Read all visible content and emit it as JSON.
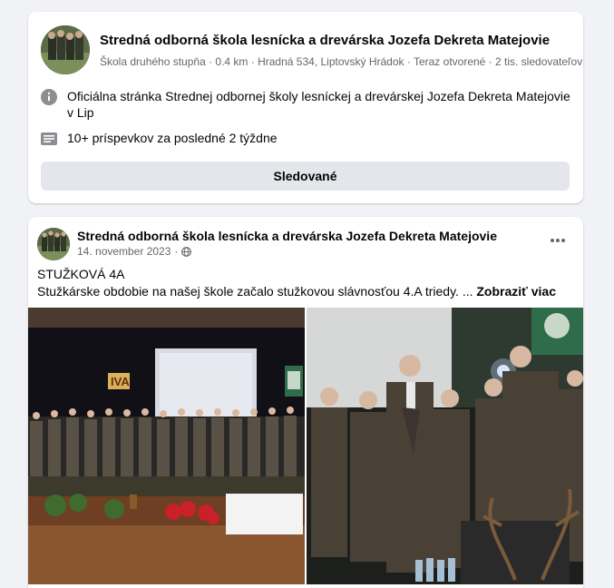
{
  "page_card": {
    "name": "Stredná odborná škola lesnícka a drevárska Jozefa Dekreta Matejovie",
    "meta": "Škola druhého stupňa · 0.4 km · Hradná 534, Liptovský Hrádok · Teraz otvorené · 2 tis. sledovateľov",
    "about_text": "Oficiálna stránka Strednej odbornej školy lesníckej a drevárskej Jozefa Dekreta Matejovie v Lip",
    "posts_text": "10+ príspevkov za posledné 2 týždne",
    "follow_button": "Sledované"
  },
  "post": {
    "author": "Stredná odborná škola lesnícka a drevárska Jozefa Dekreta Matejovie",
    "date": "14. november 2023",
    "title": "STUŽKOVÁ 4A",
    "body": "Stužkárske obdobie na našej škole začalo stužkovou slávnosťou 4.A triedy. ... ",
    "see_more": "Zobraziť viac",
    "stage_sign": "IVA"
  },
  "icons": {
    "info": "info-icon",
    "posts": "posts-icon",
    "globe": "globe-icon",
    "more": "more-icon"
  }
}
